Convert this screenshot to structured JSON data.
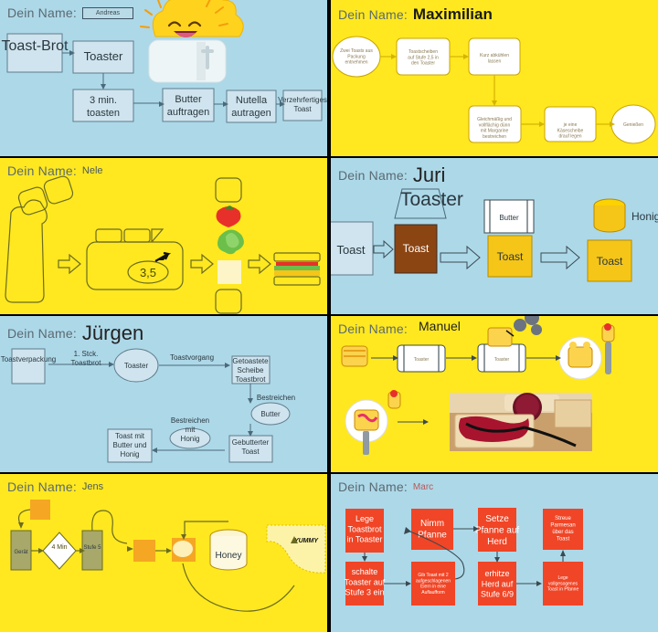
{
  "panels": [
    {
      "id": "andreas",
      "name_label": "Dein Name:",
      "name_value": "Andreas",
      "nodes": [
        "Toast-Brot",
        "Toaster",
        "3 min. toasten",
        "Butter auftragen",
        "Nutella autragen",
        "Verzehrfertiges Toast"
      ],
      "illustration": "smiling-toast-in-toaster-icon",
      "bg": "#add8e8"
    },
    {
      "id": "maximilian",
      "name_label": "Dein Name:",
      "name_value": "Maximilian",
      "nodes": [
        "Zwei Toasts aus Packung entnehmen",
        "Toastscheiben auf Stufe 2,5 in den Toaster",
        "Kurz abkühlen lassen",
        "Gleichmäßig und vollflächig dünn mit Margarine bestreichen",
        "je eine Käsescheibe drauf legen",
        "Genießen"
      ],
      "bg": "#ffe81f"
    },
    {
      "id": "nele",
      "name_label": "Dein Name:",
      "name_value": "Nele",
      "nodes": [
        "3,5"
      ],
      "illustration": "toast-bag-toaster-tomato-lettuce-cheese-sandwich-icons",
      "bg": "#ffe81f"
    },
    {
      "id": "juri",
      "name_label": "Dein Name:",
      "name_value": "Juri",
      "nodes": [
        "Toaster",
        "Toast",
        "Toast",
        "Butter",
        "Toast",
        "Honig",
        "Toast"
      ],
      "bg": "#add8e8"
    },
    {
      "id": "juergen",
      "name_label": "Dein Name:",
      "name_value": "Jürgen",
      "nodes": [
        "Toastverpackung",
        "Toaster",
        "Getoastete Scheibe Toastbrot",
        "Butter",
        "Gebutterter Toast",
        "Honig",
        "Toast mit Butter und Honig"
      ],
      "edges": [
        "1. Stck. Toastbrot",
        "Toastvorgang",
        "Bestreichen",
        "Bestreichen mit"
      ],
      "bg": "#add8e8"
    },
    {
      "id": "manuel",
      "name_label": "Dein Name:",
      "name_value": "Manuel",
      "nodes": [
        "Toaster",
        "Toaster"
      ],
      "illustration": "bread-toaster-plate-knife-jam-photo-icons",
      "bg": "#ffe81f"
    },
    {
      "id": "jens",
      "name_label": "Dein Name:",
      "name_value": "Jens",
      "nodes": [
        "Gerät",
        "4 Min",
        "Stufe 5",
        "Honey",
        "YUMMY"
      ],
      "bg": "#ffe81f"
    },
    {
      "id": "marc",
      "name_label": "Dein Name:",
      "name_value": "Marc",
      "nodes": [
        "Lege Toastbrot in Toaster",
        "Nimm Pfanne",
        "Setze Pfanne auf Herd",
        "Streue Parmesan über das Toast",
        "schalte Toaster auf Stufe 3 ein",
        "Gib Toast mit 2 aufgeschlagenen Eiern in eine Auflaufform",
        "erhitze Herd auf Stufe 6/9",
        "Lege vollgesogenes Toast in Pfanne"
      ],
      "bg": "#add8e8"
    }
  ],
  "colors": {
    "blue_bg": "#add8e8",
    "yellow_bg": "#ffe81f",
    "red_node": "#f04526",
    "gold": "#f5c518",
    "brown": "#8b4513"
  }
}
